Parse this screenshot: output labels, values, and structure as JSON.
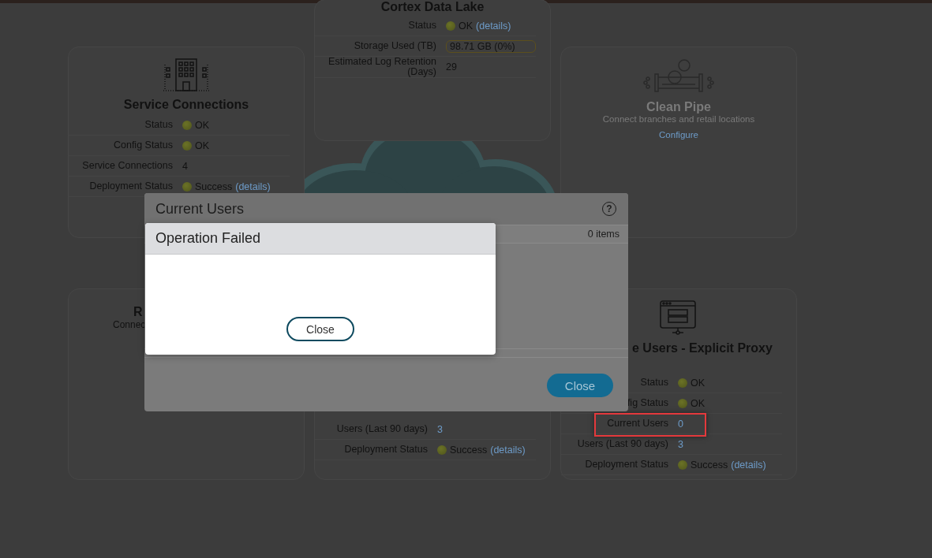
{
  "cards": [
    {
      "kind": "service",
      "title": "Service Connections",
      "rows": [
        {
          "kind": "status",
          "label": "Status",
          "value": "OK"
        },
        {
          "kind": "status",
          "label": "Config Status",
          "value": "OK"
        },
        {
          "kind": "plain",
          "label": "Service Connections",
          "value": "4"
        },
        {
          "kind": "status",
          "label": "Deployment Status",
          "value": "Success",
          "link": "(details)"
        }
      ]
    },
    {
      "kind": "cortex",
      "title": "Cortex Data Lake",
      "rows": [
        {
          "kind": "status",
          "label": "Status",
          "value": "OK",
          "link": "(details)"
        },
        {
          "kind": "meter",
          "label": "Storage Used (TB)",
          "value": "98.71 GB (0%)"
        },
        {
          "kind": "plain",
          "label": "Estimated Log Retention (Days)",
          "value": "29"
        }
      ]
    },
    {
      "kind": "pipe",
      "title": "Clean Pipe",
      "subtitle": "Connect branches and retail locations",
      "link": "Configure"
    },
    {
      "kind": "remote",
      "title": "R",
      "subtitle": "Connec"
    },
    {
      "kind": "users",
      "rows": [
        {
          "kind": "link",
          "label": "Users (Last 90 days)",
          "value": "3"
        },
        {
          "kind": "status",
          "label": "Deployment Status",
          "value": "Success",
          "link": "(details)"
        }
      ]
    },
    {
      "kind": "proxy",
      "title": "e Users - Explicit Proxy",
      "rows": [
        {
          "kind": "status",
          "label": "Status",
          "value": "OK"
        },
        {
          "kind": "status",
          "label": "fig Status",
          "value": "OK"
        },
        {
          "kind": "link",
          "label": "Current Users",
          "value": "0",
          "highlighted": true
        },
        {
          "kind": "link",
          "label": "Users (Last 90 days)",
          "value": "3"
        },
        {
          "kind": "status",
          "label": "Deployment Status",
          "value": "Success",
          "link": "(details)"
        }
      ]
    }
  ],
  "current_users_dialog": {
    "title": "Current Users",
    "help_icon": "?",
    "item_count": "0 items",
    "close_label": "Close"
  },
  "error_dialog": {
    "title": "Operation Failed",
    "close_label": "Close"
  }
}
